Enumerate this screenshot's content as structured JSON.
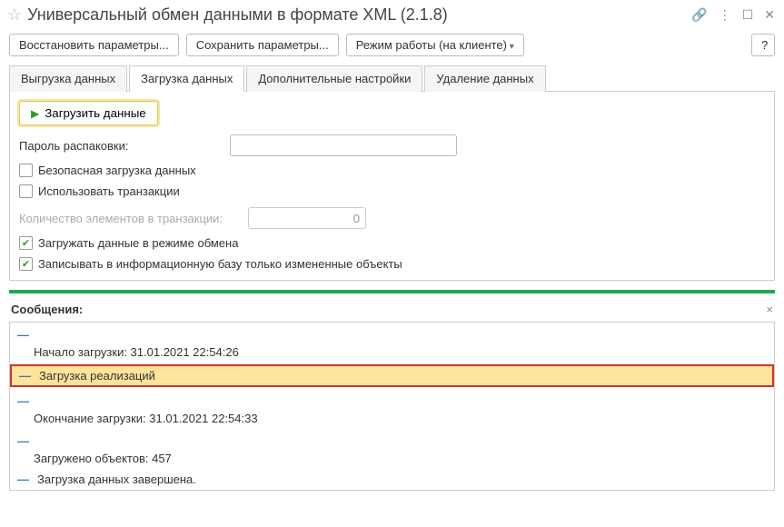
{
  "header": {
    "title": "Универсальный обмен данными в формате XML (2.1.8)"
  },
  "toolbar": {
    "restore": "Восстановить параметры...",
    "save": "Сохранить параметры...",
    "mode": "Режим работы (на клиенте)",
    "help": "?"
  },
  "tabs": {
    "export": "Выгрузка данных",
    "import": "Загрузка данных",
    "settings": "Дополнительные настройки",
    "delete": "Удаление данных"
  },
  "form": {
    "load_button": "Загрузить данные",
    "password_label": "Пароль распаковки:",
    "password_value": "",
    "safe_load": "Безопасная загрузка данных",
    "use_tx": "Использовать транзакции",
    "tx_count_label": "Количество элементов в транзакции:",
    "tx_count_value": "0",
    "load_exchange": "Загружать данные в режиме обмена",
    "write_changed": "Записывать в информационную базу только измененные объекты"
  },
  "messages": {
    "title": "Сообщения:",
    "items": [
      "Начало загрузки: 31.01.2021 22:54:26",
      "Загрузка реализаций",
      "Окончание загрузки: 31.01.2021 22:54:33",
      "Загружено объектов: 457",
      "Загрузка данных завершена."
    ]
  }
}
